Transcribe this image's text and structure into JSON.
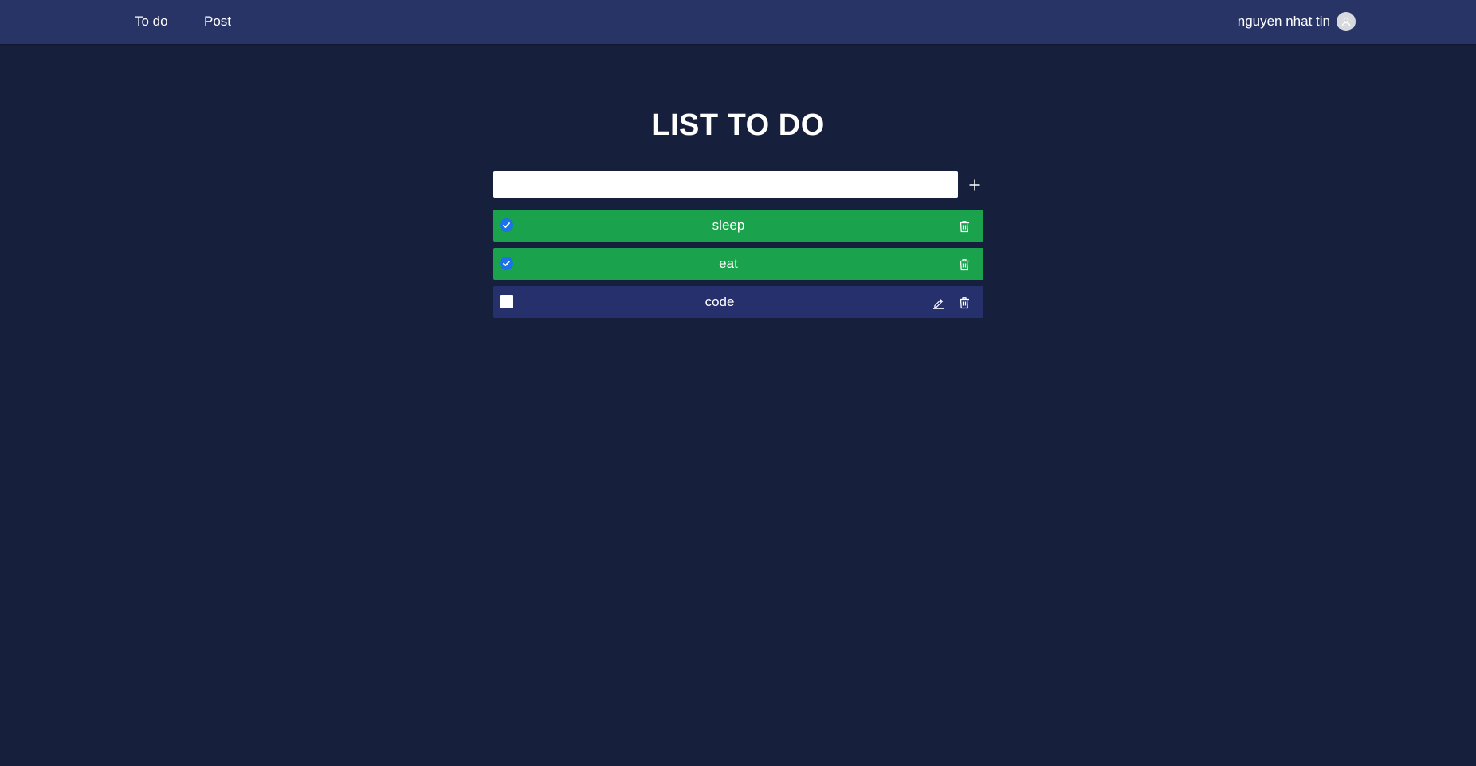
{
  "nav": {
    "links": [
      {
        "label": "To do"
      },
      {
        "label": "Post"
      }
    ],
    "user": {
      "name": "nguyen nhat tin",
      "avatar_icon": "user-icon"
    }
  },
  "main": {
    "title": "LIST TO DO",
    "input": {
      "value": "",
      "placeholder": ""
    },
    "add_icon": "plus-icon",
    "todos": [
      {
        "label": "sleep",
        "done": true
      },
      {
        "label": "eat",
        "done": true
      },
      {
        "label": "code",
        "done": false
      }
    ]
  },
  "colors": {
    "background": "#16203d",
    "navbar": "#283466",
    "done_item": "#1aa34c",
    "pending_item": "#26306c",
    "checkbox_checked": "#1a73e8"
  }
}
